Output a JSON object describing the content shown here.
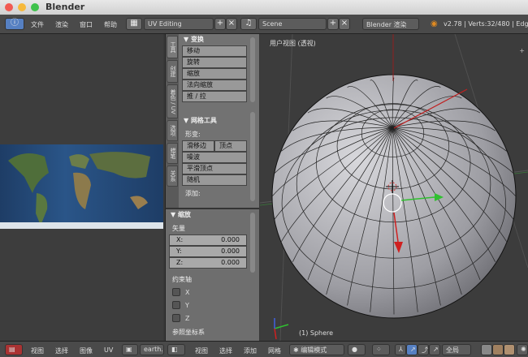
{
  "window": {
    "title": "Blender"
  },
  "menubar": {
    "info_icon": "info-icon",
    "menus": [
      "文件",
      "渲染",
      "窗口",
      "帮助"
    ],
    "layout": "UV Editing",
    "scene": "Scene",
    "engine": "Blender 渲染",
    "stats": "v2.78 | Verts:32/480 | Edge"
  },
  "tool_tabs": [
    "工具",
    "创建",
    "着色 / UV",
    "选项",
    "蜡笔",
    "关系"
  ],
  "transform_panel": {
    "title": "▼ 变换",
    "buttons": [
      "移动",
      "旋转",
      "缩放",
      "法向缩放",
      "推 / 拉"
    ]
  },
  "mesh_tools_panel": {
    "title": "▼ 网格工具",
    "deform_label": "形变:",
    "slide_edge": "滑移边",
    "vertex": "顶点",
    "noise": "噪波",
    "smooth_vertex": "平滑顶点",
    "random": "随机",
    "add_label": "添加:"
  },
  "scale_panel": {
    "title": "▼ 缩放",
    "vector_label": "矢量",
    "x_label": "X:",
    "x": "0.000",
    "y_label": "Y:",
    "y": "0.000",
    "z_label": "Z:",
    "z": "0.000",
    "constraint_label": "约束轴",
    "axes": [
      "X",
      "Y",
      "Z"
    ],
    "orientation_label": "参照坐标系"
  },
  "viewport": {
    "view_label": "用户视图 (透视)",
    "object_label": "(1) Sphere"
  },
  "uv_header": {
    "menus": [
      "视图",
      "选择",
      "图像",
      "UV"
    ],
    "image": "earth.jp"
  },
  "view3d_header": {
    "menus": [
      "视图",
      "选择",
      "添加",
      "网格"
    ],
    "mode": "编辑模式",
    "pivot": "全局"
  },
  "colors": {
    "accent": "#5680c2",
    "x_axis": "#d02020",
    "y_axis": "#30c030"
  }
}
